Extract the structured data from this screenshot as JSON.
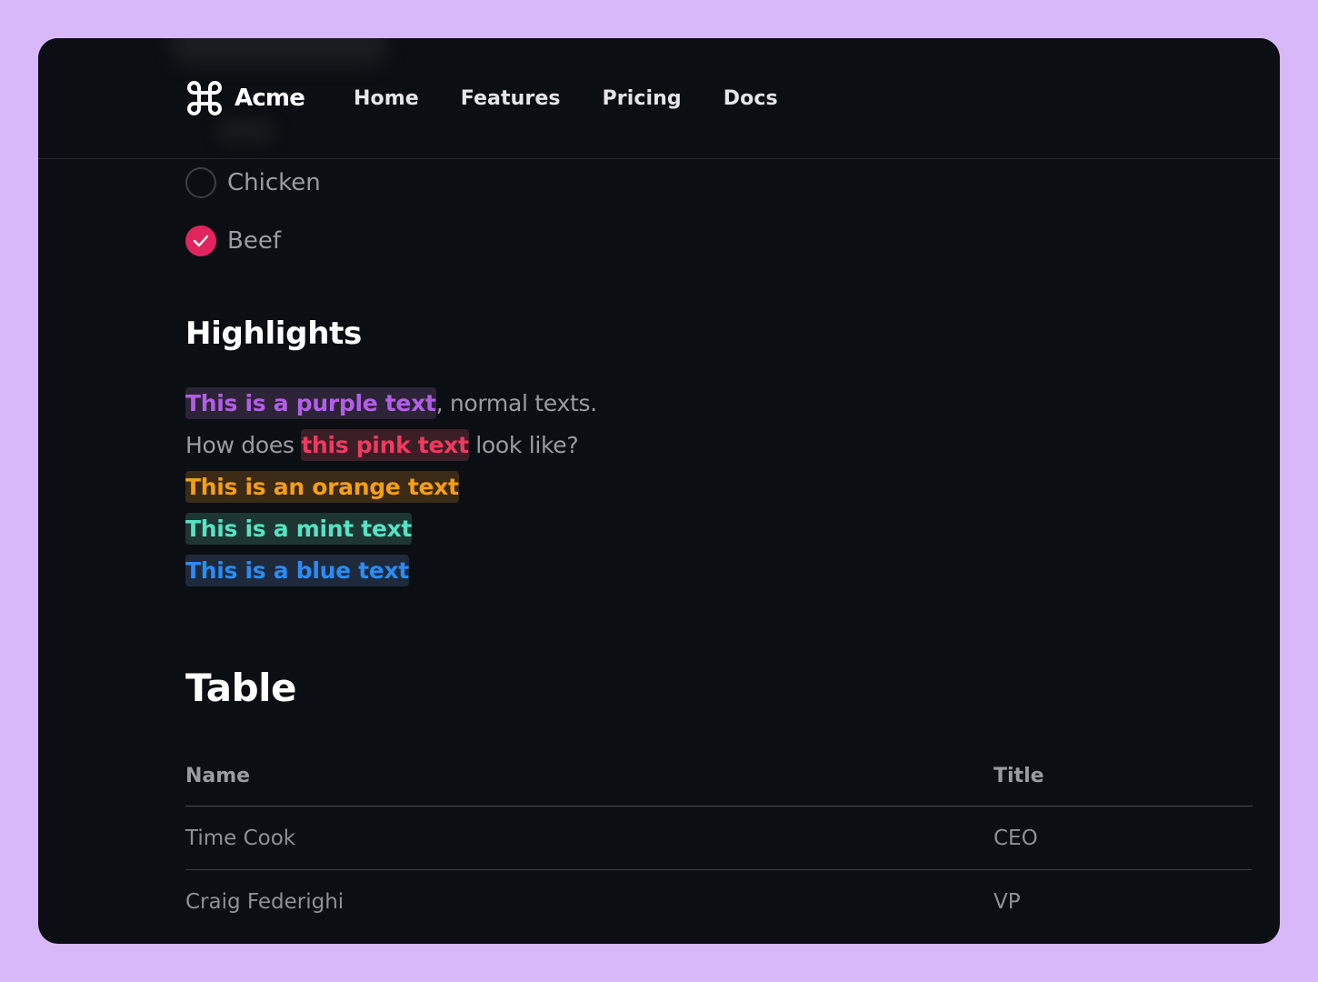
{
  "header": {
    "brand": {
      "name": "Acme",
      "icon": "command-key-icon"
    },
    "nav": [
      {
        "label": "Home"
      },
      {
        "label": "Features"
      },
      {
        "label": "Pricing"
      },
      {
        "label": "Docs"
      }
    ]
  },
  "checklist": [
    {
      "label": "Chicken",
      "checked": false
    },
    {
      "label": "Beef",
      "checked": true
    }
  ],
  "highlights": {
    "title": "Highlights",
    "line1": {
      "purple": "This is a purple text",
      "rest": ", normal texts."
    },
    "line2": {
      "before": "How does ",
      "pink": "this pink text",
      "after": " look like?"
    },
    "orange": "This is an orange text",
    "mint": "This is a mint text",
    "blue": "This is a blue text"
  },
  "table": {
    "title": "Table",
    "columns": [
      "Name",
      "Title"
    ],
    "rows": [
      [
        "Time Cook",
        "CEO"
      ],
      [
        "Craig Federighi",
        "VP"
      ]
    ]
  },
  "colors": {
    "page_background": "#d8b8f8",
    "window_background": "#0b0e12",
    "accent_pink": "#e0245e",
    "purple": "#b25ee8",
    "pink": "#f03a5f",
    "orange": "#f59f16",
    "mint": "#56e3c4",
    "blue": "#2a8cf5"
  }
}
